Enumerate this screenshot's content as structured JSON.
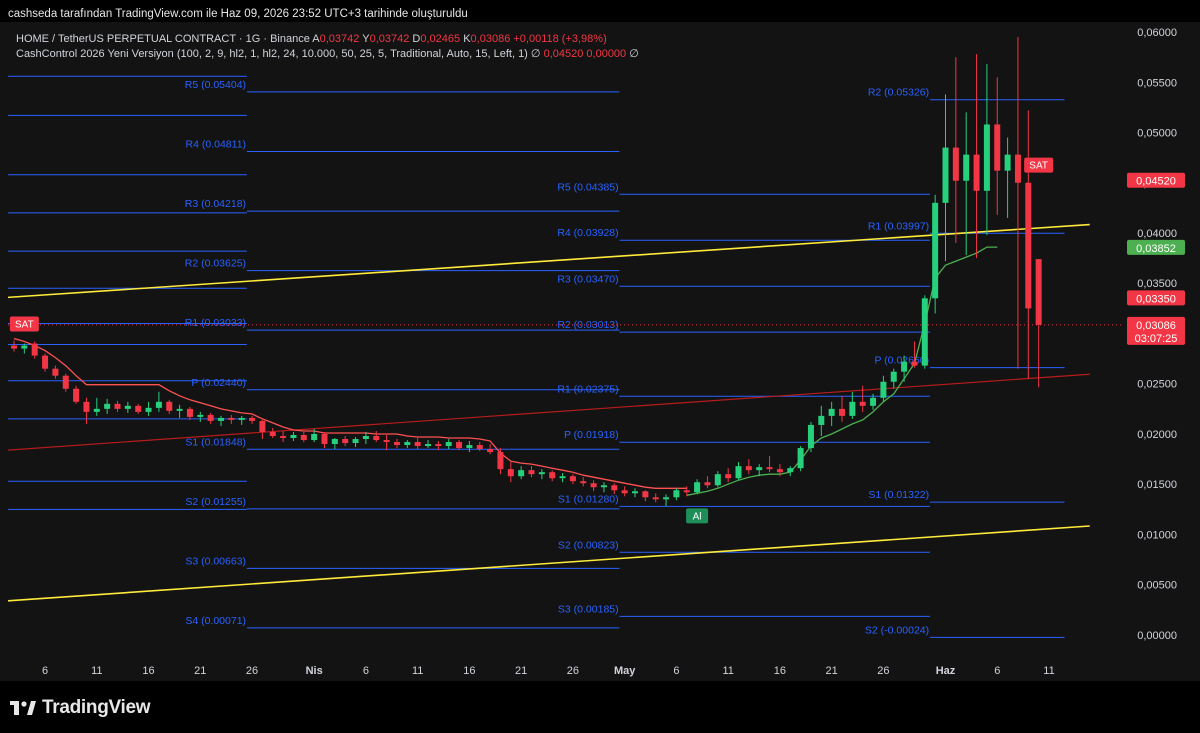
{
  "header": {
    "attribution": "cashseda tarafından TradingView.com ile Haz 09, 2026 23:52 UTC+3 tarihinde oluşturuldu"
  },
  "legend": {
    "symbol": "HOME / TetherUS PERPETUAL CONTRACT · 1G · Binance",
    "open_label": "A",
    "open": "0,03742",
    "high_label": "Y",
    "high": "0,03742",
    "low_label": "D",
    "low": "0,02465",
    "close_label": "K",
    "close": "0,03086",
    "change": "+0,00118 (+3,98%)",
    "indicator": "CashControl 2026 Yeni Versiyon (100, 2, 9, hl2, 1, hl2, 24, 10.000, 50, 25, 5, Traditional, Auto, 15, Left, 1)",
    "indicator_icon": "∅",
    "indicator_value1": "0,04520",
    "indicator_value2": "0,00000",
    "indicator_icon2": "∅"
  },
  "footer": {
    "brand": "TradingView"
  },
  "colors": {
    "background": "#131313",
    "up": "#26d07c",
    "down": "#f23645",
    "pivot": "#2962ff",
    "trend": "#ffeb3b",
    "support": "#b71c1c",
    "trail_up": "#4caf50",
    "trail_down": "#ff5252"
  },
  "chart_data": {
    "type": "candlestick",
    "ylim": [
      -0.0005,
      0.0602
    ],
    "x_ticks": [
      {
        "i": 3,
        "label": "6"
      },
      {
        "i": 8,
        "label": "11"
      },
      {
        "i": 13,
        "label": "16"
      },
      {
        "i": 18,
        "label": "21"
      },
      {
        "i": 23,
        "label": "26"
      },
      {
        "i": 29,
        "label": "Nis"
      },
      {
        "i": 34,
        "label": "6"
      },
      {
        "i": 39,
        "label": "11"
      },
      {
        "i": 44,
        "label": "16"
      },
      {
        "i": 49,
        "label": "21"
      },
      {
        "i": 54,
        "label": "26"
      },
      {
        "i": 59,
        "label": "May"
      },
      {
        "i": 64,
        "label": "6"
      },
      {
        "i": 69,
        "label": "11"
      },
      {
        "i": 74,
        "label": "16"
      },
      {
        "i": 79,
        "label": "21"
      },
      {
        "i": 84,
        "label": "26"
      },
      {
        "i": 90,
        "label": "Haz"
      },
      {
        "i": 95,
        "label": "6"
      },
      {
        "i": 100,
        "label": "11"
      }
    ],
    "y_ticks": [
      "0,06000",
      "0,05500",
      "0,05000",
      "0,04500",
      "0,04000",
      "0,03500",
      "0,03000",
      "0,02500",
      "0,02000",
      "0,01500",
      "0,01000",
      "0,00500",
      "0,00000"
    ],
    "y_tick_values": [
      0.06,
      0.055,
      0.05,
      0.045,
      0.04,
      0.035,
      0.03,
      0.025,
      0.02,
      0.015,
      0.01,
      0.005,
      0.0
    ],
    "ohlc": [
      [
        0.0288,
        0.0293,
        0.0282,
        0.0285
      ],
      [
        0.0285,
        0.029,
        0.028,
        0.0288
      ],
      [
        0.029,
        0.0292,
        0.0275,
        0.0278
      ],
      [
        0.0278,
        0.028,
        0.0262,
        0.0265
      ],
      [
        0.0265,
        0.0268,
        0.0255,
        0.0258
      ],
      [
        0.0258,
        0.026,
        0.0242,
        0.0245
      ],
      [
        0.0245,
        0.0248,
        0.023,
        0.0232
      ],
      [
        0.0232,
        0.0236,
        0.021,
        0.0222
      ],
      [
        0.0222,
        0.0236,
        0.0218,
        0.0225
      ],
      [
        0.0225,
        0.0235,
        0.022,
        0.023
      ],
      [
        0.023,
        0.0233,
        0.0222,
        0.0225
      ],
      [
        0.0225,
        0.0232,
        0.0221,
        0.0228
      ],
      [
        0.0228,
        0.023,
        0.022,
        0.0222
      ],
      [
        0.0222,
        0.0232,
        0.0218,
        0.0226
      ],
      [
        0.0226,
        0.0242,
        0.0222,
        0.0232
      ],
      [
        0.0232,
        0.0234,
        0.022,
        0.0223
      ],
      [
        0.0223,
        0.0229,
        0.0216,
        0.0225
      ],
      [
        0.0225,
        0.0227,
        0.0214,
        0.0217
      ],
      [
        0.0217,
        0.0222,
        0.0212,
        0.0219
      ],
      [
        0.0219,
        0.0221,
        0.021,
        0.0213
      ],
      [
        0.0213,
        0.0218,
        0.0208,
        0.0216
      ],
      [
        0.0216,
        0.0219,
        0.021,
        0.0214
      ],
      [
        0.0214,
        0.0218,
        0.0209,
        0.0216
      ],
      [
        0.0216,
        0.0218,
        0.021,
        0.0213
      ],
      [
        0.0213,
        0.0214,
        0.0195,
        0.0202
      ],
      [
        0.0202,
        0.0206,
        0.0196,
        0.0198
      ],
      [
        0.0198,
        0.0203,
        0.0192,
        0.0196
      ],
      [
        0.0196,
        0.0202,
        0.0193,
        0.0199
      ],
      [
        0.0199,
        0.0202,
        0.0192,
        0.0194
      ],
      [
        0.0194,
        0.0205,
        0.0192,
        0.02
      ],
      [
        0.02,
        0.0202,
        0.0186,
        0.019
      ],
      [
        0.019,
        0.0196,
        0.0185,
        0.0195
      ],
      [
        0.0195,
        0.0198,
        0.0188,
        0.0191
      ],
      [
        0.0191,
        0.0197,
        0.0187,
        0.0195
      ],
      [
        0.0195,
        0.0202,
        0.019,
        0.0198
      ],
      [
        0.0198,
        0.0203,
        0.0192,
        0.0194
      ],
      [
        0.0194,
        0.0199,
        0.0184,
        0.0192
      ],
      [
        0.0192,
        0.0195,
        0.0186,
        0.0189
      ],
      [
        0.0189,
        0.0194,
        0.0186,
        0.0192
      ],
      [
        0.0192,
        0.0196,
        0.0185,
        0.0188
      ],
      [
        0.0188,
        0.0194,
        0.0186,
        0.019
      ],
      [
        0.019,
        0.0193,
        0.0184,
        0.0188
      ],
      [
        0.0188,
        0.0195,
        0.0185,
        0.0192
      ],
      [
        0.0192,
        0.0194,
        0.0184,
        0.0186
      ],
      [
        0.0186,
        0.0193,
        0.0182,
        0.0189
      ],
      [
        0.0189,
        0.0192,
        0.0183,
        0.0185
      ],
      [
        0.0185,
        0.019,
        0.018,
        0.0182
      ],
      [
        0.0182,
        0.0186,
        0.016,
        0.0165
      ],
      [
        0.0165,
        0.0172,
        0.0152,
        0.0158
      ],
      [
        0.0158,
        0.0168,
        0.0155,
        0.0164
      ],
      [
        0.0164,
        0.0168,
        0.0157,
        0.016
      ],
      [
        0.016,
        0.0165,
        0.0155,
        0.0162
      ],
      [
        0.0162,
        0.0164,
        0.0153,
        0.0156
      ],
      [
        0.0156,
        0.0161,
        0.0152,
        0.0158
      ],
      [
        0.0158,
        0.016,
        0.015,
        0.0153
      ],
      [
        0.0153,
        0.0157,
        0.0148,
        0.0151
      ],
      [
        0.0151,
        0.0154,
        0.0143,
        0.0147
      ],
      [
        0.0147,
        0.0152,
        0.0142,
        0.0149
      ],
      [
        0.0149,
        0.0151,
        0.014,
        0.0144
      ],
      [
        0.0144,
        0.0148,
        0.0138,
        0.0141
      ],
      [
        0.0141,
        0.0146,
        0.0137,
        0.0143
      ],
      [
        0.0143,
        0.0144,
        0.0133,
        0.0137
      ],
      [
        0.0137,
        0.0141,
        0.0132,
        0.0135
      ],
      [
        0.0135,
        0.014,
        0.0128,
        0.0137
      ],
      [
        0.0137,
        0.0146,
        0.0134,
        0.0144
      ],
      [
        0.0144,
        0.0148,
        0.0138,
        0.0142
      ],
      [
        0.0142,
        0.0155,
        0.014,
        0.0152
      ],
      [
        0.0152,
        0.0158,
        0.0146,
        0.0149
      ],
      [
        0.0149,
        0.0163,
        0.0147,
        0.016
      ],
      [
        0.016,
        0.0166,
        0.0152,
        0.0156
      ],
      [
        0.0156,
        0.0172,
        0.0154,
        0.0168
      ],
      [
        0.0168,
        0.0175,
        0.016,
        0.0164
      ],
      [
        0.0164,
        0.017,
        0.0158,
        0.0167
      ],
      [
        0.0167,
        0.0178,
        0.0162,
        0.0165
      ],
      [
        0.0165,
        0.017,
        0.0158,
        0.0162
      ],
      [
        0.0162,
        0.0168,
        0.0158,
        0.0166
      ],
      [
        0.0166,
        0.0188,
        0.0163,
        0.0186
      ],
      [
        0.0186,
        0.0212,
        0.0182,
        0.0209
      ],
      [
        0.0209,
        0.0228,
        0.0198,
        0.0218
      ],
      [
        0.0218,
        0.0232,
        0.0208,
        0.0225
      ],
      [
        0.0225,
        0.0238,
        0.0212,
        0.0218
      ],
      [
        0.0218,
        0.0242,
        0.0215,
        0.0232
      ],
      [
        0.0232,
        0.0248,
        0.0222,
        0.0228
      ],
      [
        0.0228,
        0.024,
        0.0224,
        0.0236
      ],
      [
        0.0236,
        0.0258,
        0.0232,
        0.0252
      ],
      [
        0.0252,
        0.0265,
        0.0245,
        0.0262
      ],
      [
        0.0262,
        0.0278,
        0.0252,
        0.0272
      ],
      [
        0.0272,
        0.0292,
        0.0266,
        0.0268
      ],
      [
        0.0268,
        0.0338,
        0.0265,
        0.0335
      ],
      [
        0.0335,
        0.0438,
        0.032,
        0.043
      ],
      [
        0.043,
        0.0538,
        0.0372,
        0.0485
      ],
      [
        0.0485,
        0.0575,
        0.039,
        0.0452
      ],
      [
        0.0452,
        0.052,
        0.0378,
        0.0478
      ],
      [
        0.0478,
        0.0578,
        0.0375,
        0.0442
      ],
      [
        0.0442,
        0.0568,
        0.0398,
        0.0508
      ],
      [
        0.0508,
        0.0555,
        0.0418,
        0.0462
      ],
      [
        0.0462,
        0.0495,
        0.0415,
        0.0478
      ],
      [
        0.0478,
        0.0595,
        0.0265,
        0.045
      ],
      [
        0.045,
        0.0522,
        0.0255,
        0.0325
      ],
      [
        0.0374,
        0.0374,
        0.02465,
        0.03086
      ]
    ],
    "trail": [
      {
        "color": "down",
        "values": [
          0.0295,
          0.0292,
          0.0288,
          0.0283,
          0.0276,
          0.0268,
          0.0258,
          0.0249,
          0.0249,
          0.0249,
          0.0249,
          0.0249,
          0.0249,
          0.0249,
          0.0249,
          0.0243,
          0.0238,
          0.0234,
          0.0231,
          0.0228,
          0.0225,
          0.0223,
          0.0221,
          0.022,
          0.0215,
          0.0211,
          0.0207,
          0.0204,
          0.0203,
          0.0203,
          0.0201,
          0.0201,
          0.0201,
          0.0201,
          0.0201,
          0.02,
          0.02,
          0.02,
          0.0198,
          0.0197,
          0.0197,
          0.0197,
          0.0196,
          0.0196,
          0.0196,
          0.0195,
          0.0193,
          0.0181,
          0.0173,
          0.0171,
          0.017,
          0.0168,
          0.0166,
          0.0164,
          0.0162,
          0.0159,
          0.0157,
          0.0155,
          0.0153,
          0.0151,
          0.0149,
          0.0147,
          0.0146,
          0.0146,
          0.0146,
          0.0146
        ]
      },
      {
        "color": "up",
        "start": 65,
        "values": [
          0.0139,
          0.0141,
          0.0143,
          0.0146,
          0.015,
          0.0154,
          0.0157,
          0.0159,
          0.016,
          0.016,
          0.0162,
          0.0174,
          0.0188,
          0.0196,
          0.02,
          0.0205,
          0.021,
          0.0214,
          0.0222,
          0.0232,
          0.024,
          0.0255,
          0.027,
          0.031,
          0.0355,
          0.0368,
          0.0372,
          0.0376,
          0.038,
          0.0386,
          0.0386
        ]
      }
    ],
    "pivot_blocks": [
      {
        "from": 0,
        "to": 23,
        "levels": [
          0.0556,
          0.0517,
          0.0458,
          0.042,
          0.0382,
          0.0345,
          0.031,
          0.0289,
          0.0253,
          0.0215,
          0.0153,
          0.0125
        ]
      },
      {
        "from": 23,
        "to": 59,
        "labels_at": 23,
        "levels": [
          {
            "v": 0.05404,
            "label": "R5 (0.05404)"
          },
          {
            "v": 0.04811,
            "label": "R4 (0.04811)"
          },
          {
            "v": 0.04218,
            "label": "R3 (0.04218)"
          },
          {
            "v": 0.03625,
            "label": "R2 (0.03625)"
          },
          {
            "v": 0.03033,
            "label": "R1 (0.03033)"
          },
          {
            "v": 0.0244,
            "label": "P (0.02440)"
          },
          {
            "v": 0.01848,
            "label": "S1 (0.01848)"
          },
          {
            "v": 0.01255,
            "label": "S2 (0.01255)"
          },
          {
            "v": 0.00663,
            "label": "S3 (0.00663)"
          },
          {
            "v": 0.00071,
            "label": "S4 (0.00071)"
          }
        ]
      },
      {
        "from": 59,
        "to": 89,
        "labels_at": 59,
        "levels": [
          {
            "v": 0.04385,
            "label": "R5 (0.04385)"
          },
          {
            "v": 0.03928,
            "label": "R4 (0.03928)"
          },
          {
            "v": 0.0347,
            "label": "R3 (0.03470)"
          },
          {
            "v": 0.03013,
            "label": "R2 (0.03013)"
          },
          {
            "v": 0.02375,
            "label": "R1 (0.02375)"
          },
          {
            "v": 0.01918,
            "label": "P (0.01918)"
          },
          {
            "v": 0.0128,
            "label": "S1 (0.01280)"
          },
          {
            "v": 0.00823,
            "label": "S2 (0.00823)"
          },
          {
            "v": 0.00185,
            "label": "S3 (0.00185)"
          }
        ]
      },
      {
        "from": 89,
        "to": 102,
        "labels_at": 89,
        "levels": [
          {
            "v": 0.05326,
            "label": "R2 (0.05326)"
          },
          {
            "v": 0.03997,
            "label": "R1 (0.03997)"
          },
          {
            "v": 0.0266,
            "label": "P (0.02660)"
          },
          {
            "v": 0.01322,
            "label": "S1 (0.01322)"
          },
          {
            "v": -0.00024,
            "label": "S2 (-0.00024)"
          }
        ]
      }
    ],
    "trendlines": [
      {
        "name": "upper",
        "color": "trend",
        "x1": 0,
        "y1": 0.0335,
        "x2": 102,
        "y2": 0.0407
      },
      {
        "name": "lower",
        "color": "trend",
        "x1": 0,
        "y1": 0.0033,
        "x2": 102,
        "y2": 0.0107
      },
      {
        "name": "support",
        "color": "support",
        "x1": 0,
        "y1": 0.0183,
        "x2": 102,
        "y2": 0.0258
      }
    ],
    "signals": [
      {
        "i": 1,
        "text": "SAT",
        "kind": "sell",
        "y": 0.0309
      },
      {
        "i": 66,
        "text": "Al",
        "kind": "buy",
        "y": 0.0118
      },
      {
        "i": 99,
        "text": "SAT",
        "kind": "sell",
        "y": 0.0467
      }
    ],
    "price_labels": [
      {
        "v": 0.0452,
        "text": "0,04520",
        "color": "down"
      },
      {
        "v": 0.03852,
        "text": "0,03852",
        "color": "trail_up"
      },
      {
        "v": 0.0335,
        "text": "0,03350",
        "color": "down"
      },
      {
        "v": 0.03086,
        "text": "0,03086",
        "sub": "03:07:25",
        "color": "down"
      }
    ],
    "current_price": 0.03086
  }
}
